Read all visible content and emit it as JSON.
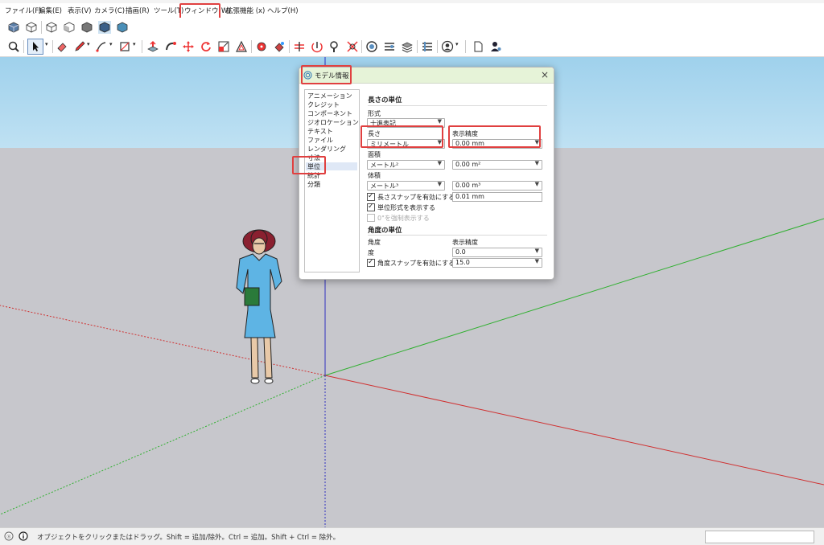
{
  "menubar": {
    "items": [
      "ファイル(F)",
      "編集(E)",
      "表示(V)",
      "カメラ(C)",
      "描画(R)",
      "ツール(T)",
      "ウィンドウ(W)",
      "拡張機能 (x)",
      "ヘルプ(H)"
    ]
  },
  "dialog": {
    "title": "モデル情報",
    "close_icon": "×",
    "nav": [
      "アニメーション",
      "クレジット",
      "コンポーネント",
      "ジオロケーション",
      "テキスト",
      "ファイル",
      "レンダリング",
      "寸法",
      "単位",
      "統計",
      "分類"
    ],
    "nav_selected": "単位",
    "length_section": "長さの単位",
    "format_label": "形式",
    "format_value": "十進表記",
    "length_label": "長さ",
    "length_value": "ミリメートル",
    "length_precision_label": "表示精度",
    "length_precision_value": "0.00 mm",
    "area_label": "面積",
    "area_unit": "メートル²",
    "area_precision": "0.00 m²",
    "volume_label": "体積",
    "volume_unit": "メートル³",
    "volume_precision": "0.00 m³",
    "length_snap_label": "長さスナップを有効にする",
    "length_snap_value": "0.01 mm",
    "show_unit_label": "単位形式を表示する",
    "force_zero_label": "0\"を強制表示する",
    "angle_section": "角度の単位",
    "angle_label": "角度",
    "angle_precision_label": "表示精度",
    "degree_label": "度",
    "angle_precision_value": "0.0",
    "angle_snap_label": "角度スナップを有効にする",
    "angle_snap_value": "15.0"
  },
  "status": {
    "text": "オブジェクトをクリックまたはドラッグ。Shift = 追加/除外。Ctrl = 追加。Shift + Ctrl = 除外。"
  },
  "colors": {
    "highlight": "#e04040",
    "sky": "#b0daf0",
    "ground": "#c7c7cc",
    "axis_red": "#d03030",
    "axis_green": "#30b030",
    "axis_blue": "#3030c0"
  },
  "toolbar_icons": [
    "iso-view-icon",
    "top-view-icon",
    "front-view-icon",
    "right-view-icon",
    "back-view-icon",
    "left-view-icon",
    "bottom-view-icon",
    "search-icon",
    "select-icon",
    "eraser-icon",
    "pencil-icon",
    "line-icon",
    "rectangle-icon",
    "push-pull-icon",
    "follow-me-icon",
    "move-icon",
    "rotate-icon",
    "scale-icon",
    "offset-icon",
    "tape-measure-icon",
    "paint-icon",
    "section-icon",
    "orbit-icon",
    "zoom-icon",
    "zoom-extents-icon",
    "warehouse-icon",
    "extension-icon",
    "layers-icon",
    "styles-icon",
    "user-icon",
    "new-file-icon",
    "account-icon"
  ]
}
